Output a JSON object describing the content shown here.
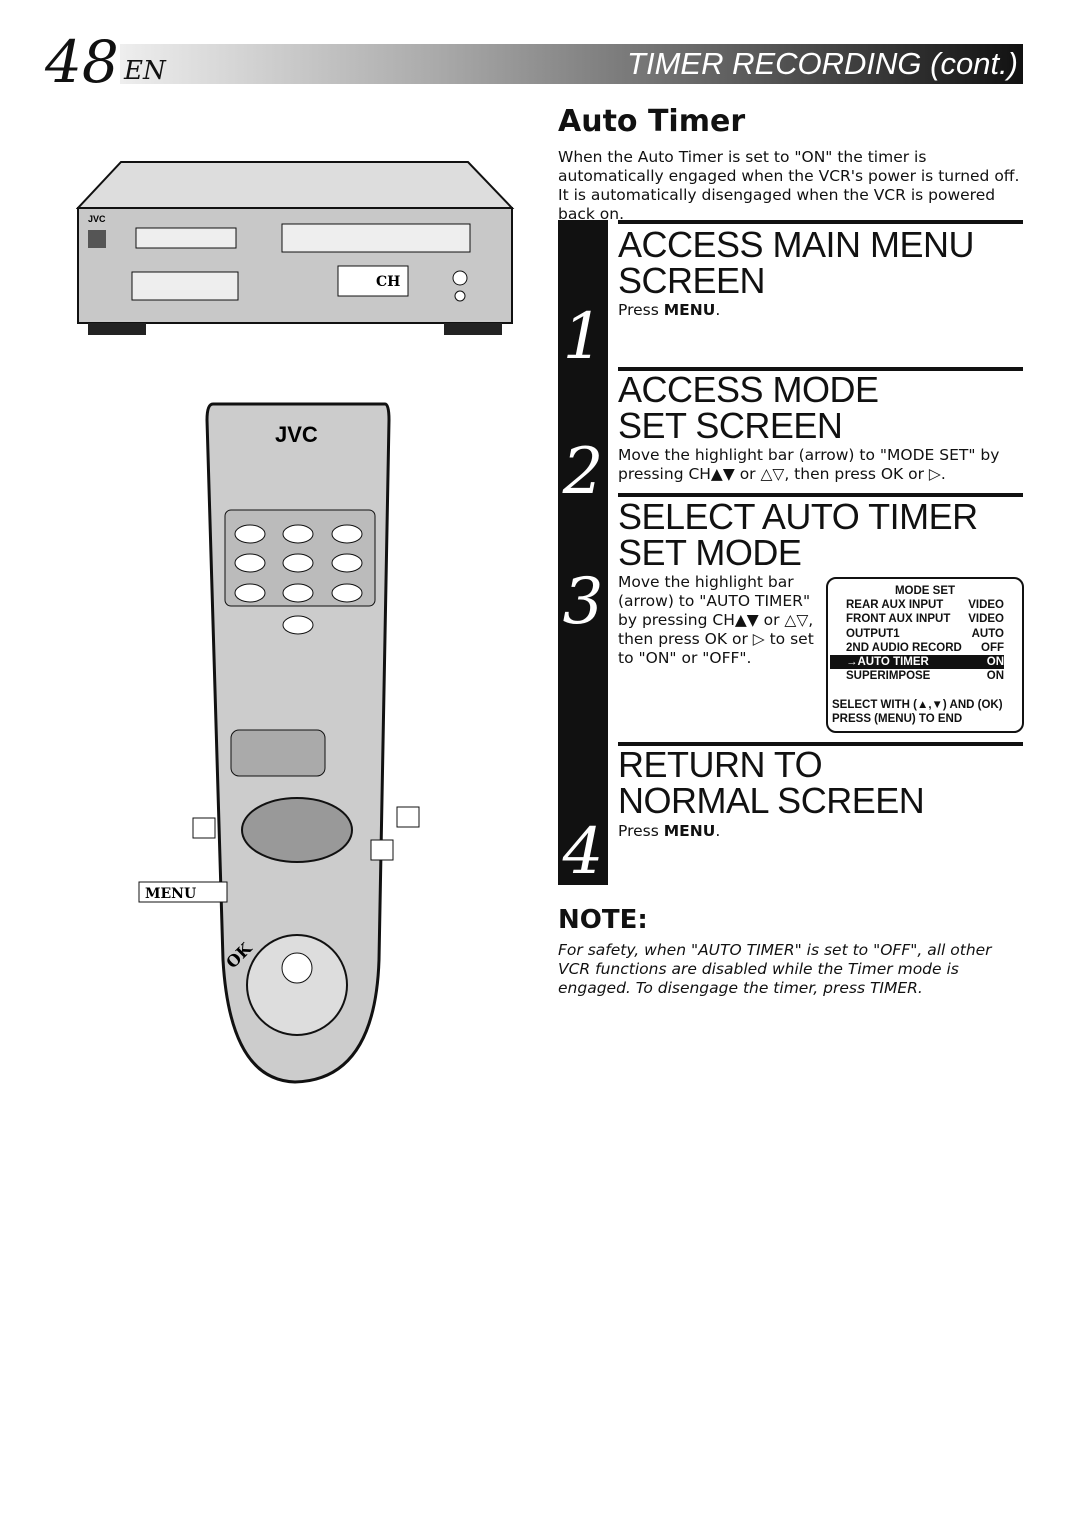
{
  "header": {
    "page_number": "48",
    "lang": "EN",
    "section_title": "TIMER RECORDING (cont.)"
  },
  "title": "Auto Timer",
  "intro": "When the Auto Timer is set to \"ON\" the timer is automatically engaged when the VCR's power is turned off. It is automatically disengaged when the VCR is powered back on.",
  "steps": [
    {
      "number": "1",
      "heading": "ACCESS MAIN MENU SCREEN",
      "text_pre": "Press ",
      "key": "MENU",
      "text_post": "."
    },
    {
      "number": "2",
      "heading": "ACCESS MODE SET SCREEN",
      "text": "Move the highlight bar (arrow) to \"MODE SET\" by pressing CH▲▼ or △▽, then press OK or ▷."
    },
    {
      "number": "3",
      "heading": "SELECT AUTO TIMER SET MODE",
      "text": "Move the highlight bar (arrow) to \"AUTO TIMER\" by pressing CH▲▼ or △▽, then press OK or ▷ to set to \"ON\" or \"OFF\"."
    },
    {
      "number": "4",
      "heading": "RETURN TO NORMAL SCREEN",
      "text_pre": "Press ",
      "key": "MENU",
      "text_post": "."
    }
  ],
  "osd": {
    "title": "MODE SET",
    "rows": [
      {
        "label": "REAR AUX INPUT",
        "value": "VIDEO"
      },
      {
        "label": "FRONT AUX INPUT",
        "value": "VIDEO"
      },
      {
        "label": "OUTPUT1",
        "value": "AUTO"
      },
      {
        "label": "2ND AUDIO RECORD",
        "value": "OFF"
      },
      {
        "label": "→AUTO TIMER",
        "value": "ON",
        "selected": true
      },
      {
        "label": "SUPERIMPOSE",
        "value": "ON"
      }
    ],
    "footer1": "SELECT WITH (▲,▼) AND (OK)",
    "footer2": "PRESS (MENU) TO END"
  },
  "note": {
    "title": "NOTE:",
    "text": "For safety, when \"AUTO TIMER\" is set to \"OFF\", all other VCR functions are disabled while the Timer mode is engaged. To disengage the timer, press TIMER."
  },
  "illustration": {
    "vcr_brand": "JVC",
    "ch_label": "CH",
    "remote_brand": "JVC",
    "menu_label": "MENU",
    "ok_label": "OK"
  }
}
